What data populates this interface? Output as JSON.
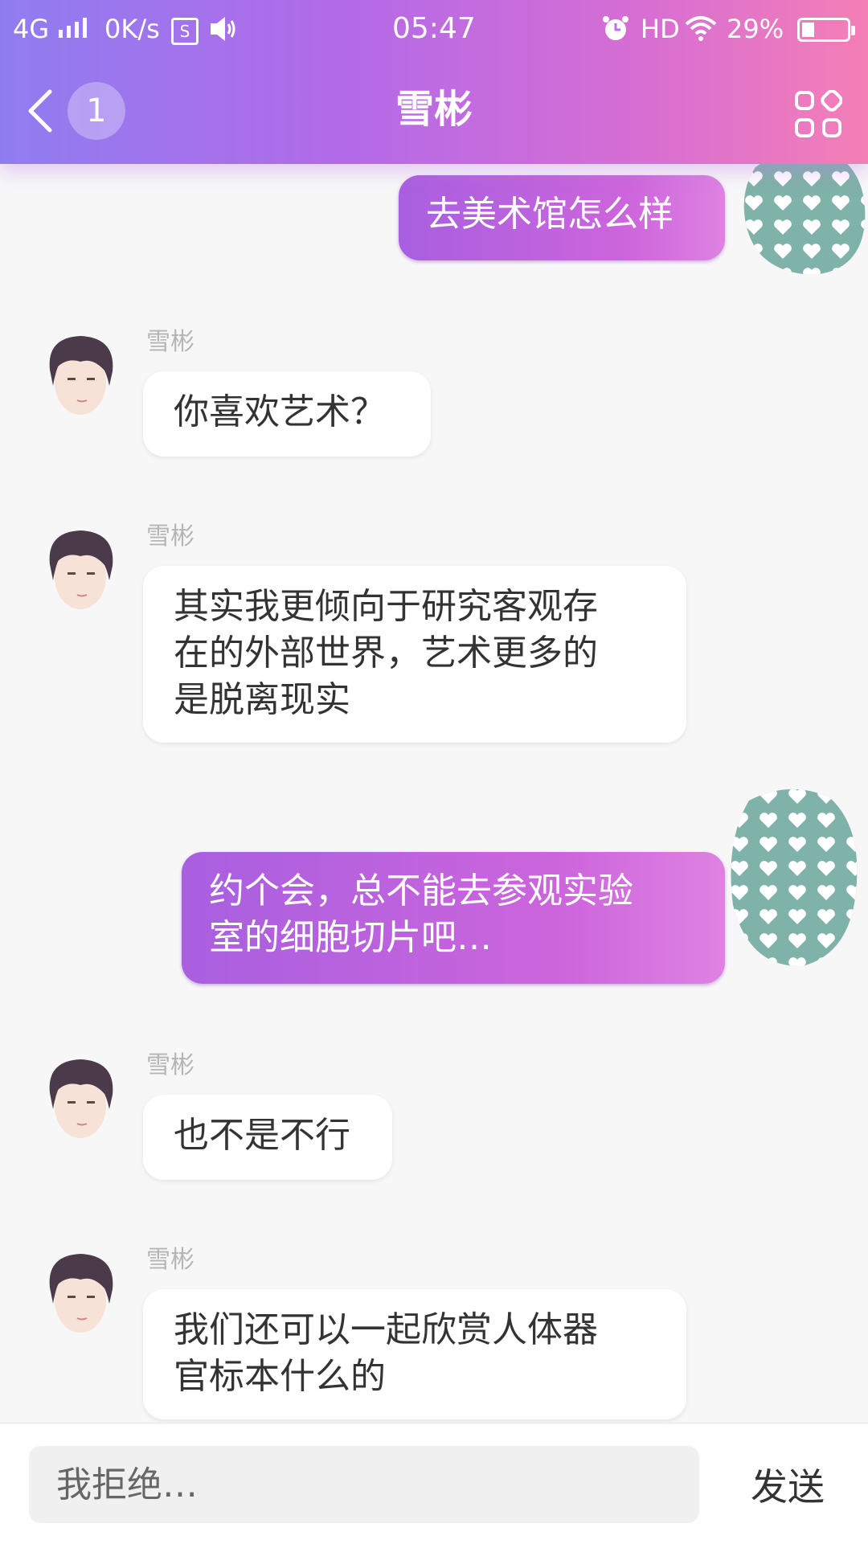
{
  "status_bar": {
    "signal": "4G",
    "speed": "0K/s",
    "time": "05:47",
    "hd": "HD",
    "battery": "29%"
  },
  "header": {
    "back_icon": "chevron-left-icon",
    "unread_badge": "1",
    "title": "雪彬",
    "menu_icon": "grid-menu-icon"
  },
  "messages": [
    {
      "from": "me",
      "text": "去美术馆怎么样"
    },
    {
      "from": "contact",
      "sender": "雪彬",
      "lines": [
        "你喜欢艺术？"
      ]
    },
    {
      "from": "contact",
      "sender": "雪彬",
      "lines": [
        "其实我更倾向于研究客观存",
        "在的外部世界，艺术更多的",
        "是脱离现实"
      ]
    },
    {
      "from": "me",
      "lines": [
        "约个会，总不能去参观实验",
        "室的细胞切片吧…"
      ]
    },
    {
      "from": "contact",
      "sender": "雪彬",
      "lines": [
        "也不是不行"
      ]
    },
    {
      "from": "contact",
      "sender": "雪彬",
      "lines": [
        "我们还可以一起欣赏人体器",
        "官标本什么的"
      ]
    }
  ],
  "input_bar": {
    "placeholder": "我拒绝…",
    "send_label": "发送"
  },
  "colors": {
    "header_start": "#8f7df0",
    "header_end": "#f47fb6",
    "outgoing_bubble": "#c062de",
    "user_avatar_bg": "#7fb2a8"
  }
}
